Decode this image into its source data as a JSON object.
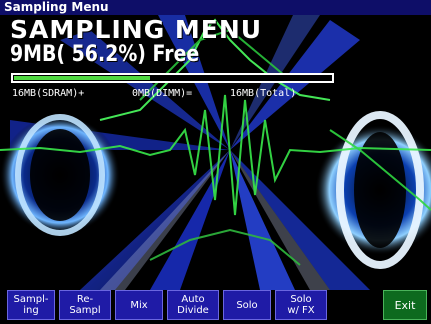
{
  "window": {
    "title": "Sampling Menu"
  },
  "main": {
    "heading": "SAMPLING MENU",
    "free_memory": "9MB( 56.2%) Free",
    "usage_fraction": 0.43,
    "memory": {
      "sdram": "16MB(SDRAM)+",
      "dimm": "0MB(DIMM)=",
      "total": "16MB(Total)"
    }
  },
  "buttons": {
    "sampling": "Sampl-\ning",
    "resample": "Re-\nSampl",
    "mix": "Mix",
    "auto_divide": "Auto\nDivide",
    "solo": "Solo",
    "solo_fx": "Solo\nw/ FX",
    "exit": "Exit"
  },
  "colors": {
    "titlebar": "#0e0e68",
    "button": "#1f1ba6",
    "exit_button": "#0d6a1e",
    "bar_fill": "#4fd840"
  }
}
